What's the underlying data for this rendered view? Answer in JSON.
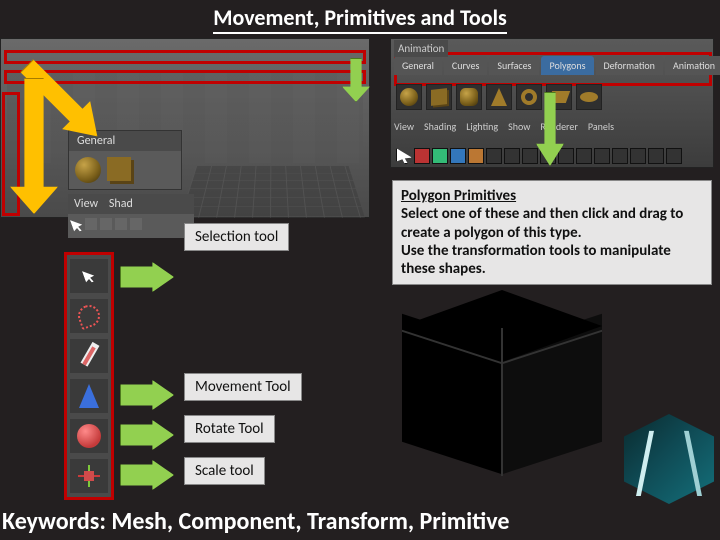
{
  "title": "Movement, Primitives and Tools",
  "panels": {
    "general_header": "General",
    "view_header": "View",
    "shad_header": "Shad"
  },
  "tabs": {
    "animation": "Animation",
    "general": "General",
    "curves": "Curves",
    "surfaces": "Surfaces",
    "polygons": "Polygons",
    "deformation": "Deformation",
    "animation2": "Animation"
  },
  "labels": {
    "selection_tool": "Selection tool",
    "movement_tool": "Movement Tool",
    "rotate_tool": "Rotate Tool",
    "scale_tool": "Scale tool"
  },
  "explain": {
    "heading": "Polygon Primitives",
    "line1": "Select one of these and then click and drag to create a polygon of this type.",
    "line2": "Use the transformation tools to manipulate these shapes."
  },
  "keywords": "Keywords: Mesh, Component, Transform, Primitive",
  "colors": {
    "highlight_red": "#c00000",
    "arrow_yellow": "#ffc000",
    "arrow_green": "#92d050",
    "cone_move": "#3a6fdc",
    "cone_rotate": "#c43a3a",
    "cone_scale": "#d04b4b"
  }
}
